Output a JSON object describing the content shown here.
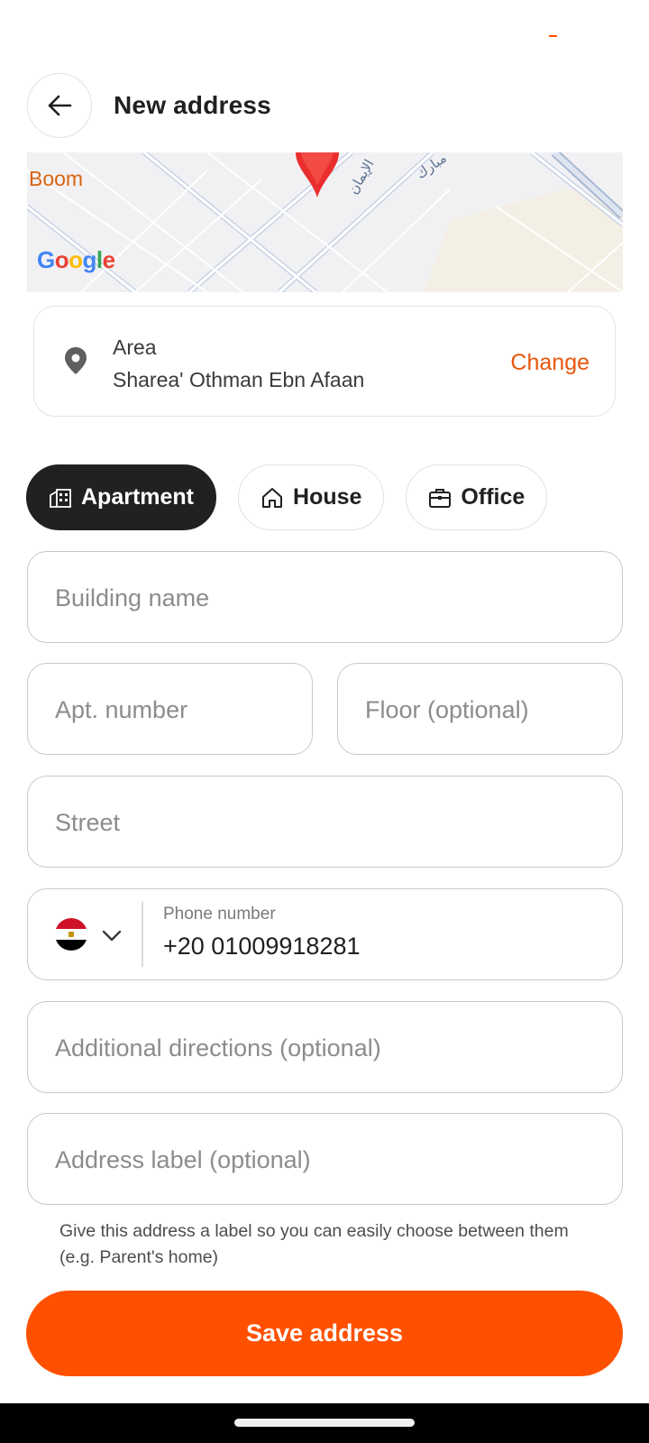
{
  "header": {
    "title": "New address",
    "back_icon": "arrow-left-icon"
  },
  "map": {
    "place_label": "Boom",
    "attribution": "Google",
    "street_labels": [
      "الإيمان",
      "مبارك"
    ],
    "marker_icon": "map-pin-icon"
  },
  "area": {
    "label": "Area",
    "value": "Sharea' Othman Ebn Afaan",
    "change_label": "Change",
    "icon": "location-pin-icon"
  },
  "address_types": [
    {
      "label": "Apartment",
      "icon": "building-icon",
      "selected": true
    },
    {
      "label": "House",
      "icon": "house-icon",
      "selected": false
    },
    {
      "label": "Office",
      "icon": "briefcase-icon",
      "selected": false
    }
  ],
  "form": {
    "building_placeholder": "Building name",
    "apt_placeholder": "Apt. number",
    "floor_placeholder": "Floor (optional)",
    "street_placeholder": "Street",
    "phone": {
      "label": "Phone number",
      "value": "+20 01009918281",
      "country_flag": "egypt-flag-icon"
    },
    "directions_placeholder": "Additional directions (optional)",
    "address_label_placeholder": "Address label (optional)",
    "helper_text": "Give this address a label so you can easily choose between them (e.g. Parent's home)"
  },
  "save_label": "Save address",
  "colors": {
    "accent": "#ff5000",
    "link": "#e8560b",
    "selected_chip": "#212121"
  }
}
